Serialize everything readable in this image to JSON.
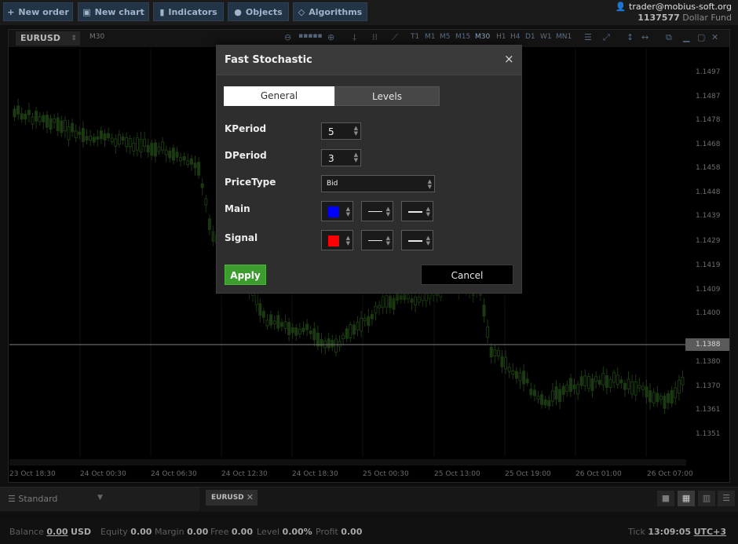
{
  "toolbar": {
    "buttons": [
      {
        "label": "New order",
        "icon": "plus-icon"
      },
      {
        "label": "New chart",
        "icon": "chart-window-icon"
      },
      {
        "label": "Indicators",
        "icon": "indicators-icon"
      },
      {
        "label": "Objects",
        "icon": "objects-icon"
      },
      {
        "label": "Algorithms",
        "icon": "algorithms-icon"
      }
    ]
  },
  "account": {
    "user": "trader@mobius-soft.org",
    "number": "1137577",
    "fund": "Dollar Fund"
  },
  "chart": {
    "symbol": "EURUSD",
    "timeframe": "M30",
    "timeframes": [
      "T1",
      "M1",
      "M5",
      "M15",
      "M30",
      "H1",
      "H4",
      "D1",
      "W1",
      "MN1"
    ],
    "active_timeframe": "M30",
    "price_ticks": [
      "1.1497",
      "1.1487",
      "1.1478",
      "1.1468",
      "1.1458",
      "1.1448",
      "1.1439",
      "1.1429",
      "1.1419",
      "1.1409",
      "1.1400",
      "1.1380",
      "1.1370",
      "1.1361",
      "1.1351"
    ],
    "current_price": "1.1388",
    "time_labels": [
      "23 Oct 18:30",
      "24 Oct 00:30",
      "24 Oct 06:30",
      "24 Oct 12:30",
      "24 Oct 18:30",
      "25 Oct 00:30",
      "25 Oct 13:00",
      "25 Oct 19:00",
      "26 Oct 01:00",
      "26 Oct 07:00"
    ],
    "colors": {
      "up": "#1c3a12",
      "down": "#1c3a12",
      "price_line": "#7f7f7f"
    }
  },
  "bottom": {
    "layout_label": "Standard",
    "doc_tab": "EURUSD"
  },
  "status": {
    "balance_label": "Balance",
    "balance": "0.00",
    "balance_ccy": "USD",
    "equity_label": "Equity",
    "equity": "0.00",
    "margin_label": "Margin",
    "margin": "0.00",
    "free_label": "Free",
    "free": "0.00",
    "level_label": "Level",
    "level": "0.00%",
    "profit_label": "Profit",
    "profit": "0.00",
    "tick_label": "Tick",
    "time": "13:09:05",
    "tz": "UTC+3"
  },
  "dialog": {
    "title": "Fast Stochastic",
    "close": "×",
    "tabs": [
      "General",
      "Levels"
    ],
    "active_tab": "General",
    "params": [
      {
        "label": "KPeriod",
        "value": "5"
      },
      {
        "label": "DPeriod",
        "value": "3"
      },
      {
        "label": "PriceType",
        "value": "Bid"
      },
      {
        "label": "Main",
        "color": "#0000ff"
      },
      {
        "label": "Signal",
        "color": "#ff0000"
      }
    ],
    "apply": "Apply",
    "cancel": "Cancel"
  }
}
